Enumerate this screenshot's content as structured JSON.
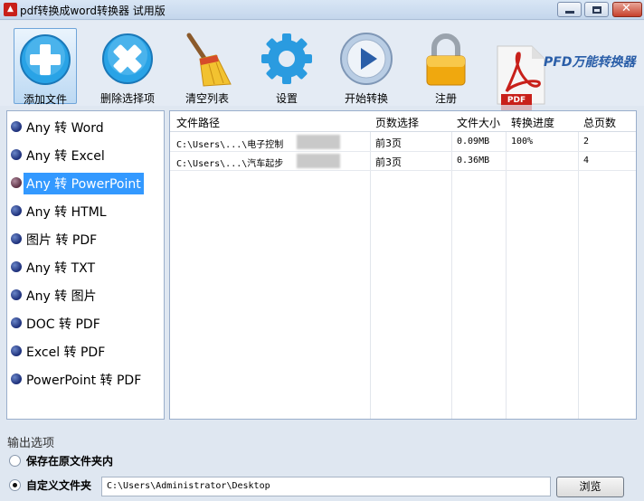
{
  "window": {
    "title": "pdf转换成word转换器 试用版",
    "app_icon": "pdf-app-icon"
  },
  "toolbar": {
    "add_label": "添加文件",
    "delete_label": "删除选择项",
    "clear_label": "清空列表",
    "settings_label": "设置",
    "start_label": "开始转换",
    "register_label": "注册"
  },
  "brand": {
    "text": "PFD万能转换器",
    "pdf_badge": "PDF"
  },
  "conversions": [
    {
      "label": "Any 转 Word",
      "selected": false
    },
    {
      "label": "Any 转 Excel",
      "selected": false
    },
    {
      "label": "Any 转 PowerPoint",
      "selected": true
    },
    {
      "label": "Any 转 HTML",
      "selected": false
    },
    {
      "label": "图片 转 PDF",
      "selected": false
    },
    {
      "label": "Any 转 TXT",
      "selected": false
    },
    {
      "label": "Any 转 图片",
      "selected": false
    },
    {
      "label": "DOC 转 PDF",
      "selected": false
    },
    {
      "label": "Excel 转 PDF",
      "selected": false
    },
    {
      "label": "PowerPoint 转 PDF",
      "selected": false
    }
  ],
  "table": {
    "headers": [
      "文件路径",
      "页数选择",
      "文件大小",
      "转换进度",
      "总页数"
    ],
    "rows": [
      {
        "path": "C:\\Users\\...\\电子控制",
        "pages_sel": "前3页",
        "size": "0.09MB",
        "progress": "100%",
        "total": "2"
      },
      {
        "path": "C:\\Users\\...\\汽车起步",
        "pages_sel": "前3页",
        "size": "0.36MB",
        "progress": "",
        "total": "4"
      }
    ]
  },
  "output": {
    "title": "输出选项",
    "option_original": "保存在原文件夹内",
    "option_custom": "自定义文件夹",
    "selected": "custom",
    "path": "C:\\Users\\Administrator\\Desktop",
    "browse_label": "浏览"
  },
  "colors": {
    "accent": "#3399ff",
    "add_icon": "#29a3e6",
    "title_bg": "#c4d6ec"
  }
}
